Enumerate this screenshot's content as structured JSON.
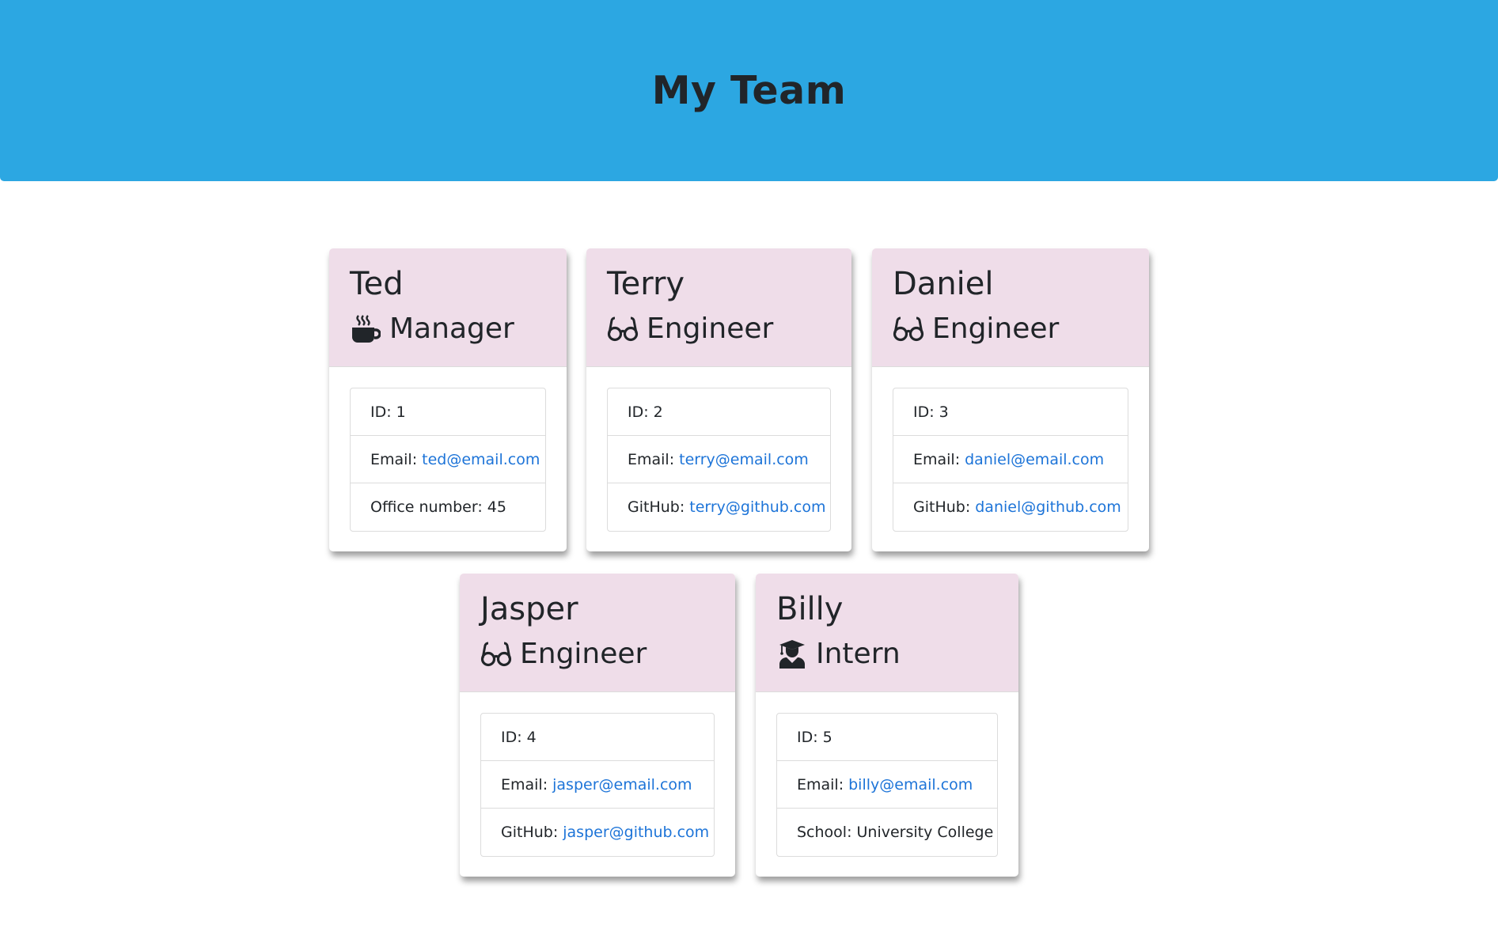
{
  "header": {
    "title": "My Team"
  },
  "employees": [
    {
      "name": "Ted",
      "role": "Manager",
      "icon": "coffee-icon",
      "id_text": "ID: 1",
      "email_label": "Email:",
      "email": "ted@email.com",
      "extra_label": "Office number: 45",
      "extra_value": ""
    },
    {
      "name": "Terry",
      "role": "Engineer",
      "icon": "glasses-icon",
      "id_text": "ID: 2",
      "email_label": "Email:",
      "email": "terry@email.com",
      "extra_label": "GitHub:",
      "extra_value": "terry@github.com"
    },
    {
      "name": "Daniel",
      "role": "Engineer",
      "icon": "glasses-icon",
      "id_text": "ID: 3",
      "email_label": "Email:",
      "email": "daniel@email.com",
      "extra_label": "GitHub:",
      "extra_value": "daniel@github.com"
    },
    {
      "name": "Jasper",
      "role": "Engineer",
      "icon": "glasses-icon",
      "id_text": "ID: 4",
      "email_label": "Email:",
      "email": "jasper@email.com",
      "extra_label": "GitHub:",
      "extra_value": "jasper@github.com"
    },
    {
      "name": "Billy",
      "role": "Intern",
      "icon": "graduate-icon",
      "id_text": "ID: 5",
      "email_label": "Email:",
      "email": "billy@email.com",
      "extra_label": "School: University College",
      "extra_value": ""
    }
  ],
  "colors": {
    "header_bg": "#2ca7e2",
    "card_header_bg": "#efdde9",
    "link": "#1d74d8"
  }
}
